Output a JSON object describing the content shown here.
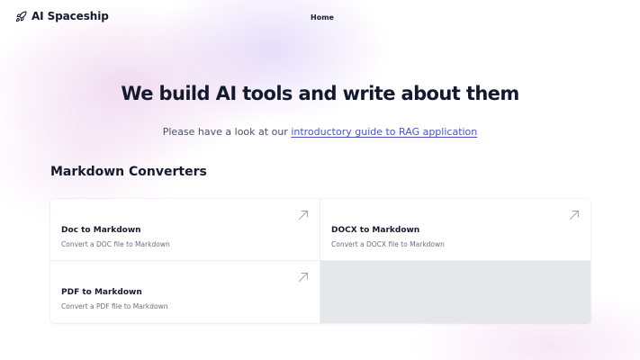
{
  "header": {
    "logo_text": "AI Spaceship",
    "logo_icon": "rocket-icon",
    "nav": [
      {
        "label": "Home"
      }
    ]
  },
  "hero": {
    "title": "We build AI tools and write about them",
    "subtitle_prefix": "Please have a look at our ",
    "subtitle_link": "introductory guide to RAG application"
  },
  "section": {
    "title": "Markdown Converters"
  },
  "cards": [
    {
      "title": "Doc to Markdown",
      "description": "Convert a DOC file to Markdown",
      "icon": "arrow-up-right-icon"
    },
    {
      "title": "DOCX to Markdown",
      "description": "Convert a DOCX file to Markdown",
      "icon": "arrow-up-right-icon"
    },
    {
      "title": "PDF to Markdown",
      "description": "Convert a PDF file to Markdown",
      "icon": "arrow-up-right-icon"
    }
  ],
  "colors": {
    "text": "#141a2e",
    "link": "#4b53c4",
    "muted": "#6b7080",
    "empty_cell": "#e5e7eb"
  }
}
